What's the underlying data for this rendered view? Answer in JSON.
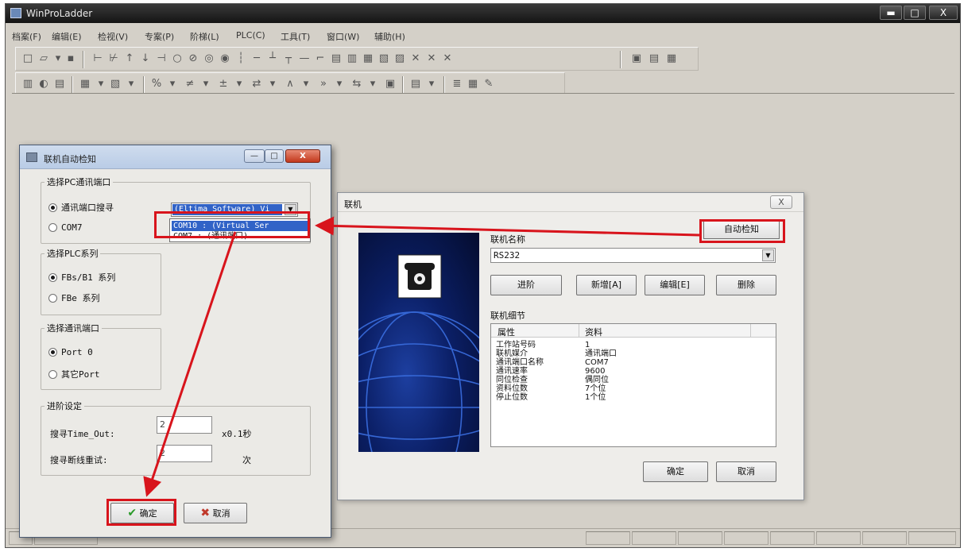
{
  "app": {
    "title": "WinProLadder",
    "window_buttons": [
      "▬",
      "□",
      "X"
    ],
    "menu": [
      "档案(F)",
      "编辑(E)",
      "检视(V)",
      "专案(P)",
      "阶梯(L)",
      "PLC(C)",
      "工具(T)",
      "窗口(W)",
      "辅助(H)"
    ]
  },
  "autodetect_dialog": {
    "title": "联机自动检知",
    "caption_buttons": [
      "—",
      "□",
      "X"
    ],
    "pc_port_group": {
      "legend": "选择PC通讯端口",
      "option_search": "通讯端口搜寻",
      "option_com7": "COM7",
      "combo_value": "(Eltima Software) Vi",
      "dropdown_items": [
        "COM10 : (Virtual Ser",
        "COM7 : (通讯端口)"
      ]
    },
    "plc_series_group": {
      "legend": "选择PLC系列",
      "option_fbs": "FBs/B1 系列",
      "option_fbe": "FBe 系列"
    },
    "comm_port_group": {
      "legend": "选择通讯端口",
      "option_port0": "Port 0",
      "option_other": "其它Port"
    },
    "advanced_group": {
      "legend": "进阶设定",
      "timeout_label": "搜寻Time_Out:",
      "timeout_value": "2",
      "timeout_unit": "x0.1秒",
      "retry_label": "搜寻断线重试:",
      "retry_value": "2",
      "retry_unit": "次"
    },
    "ok_label": "确定",
    "cancel_label": "取消"
  },
  "link_dialog": {
    "title": "联机",
    "close_label": "X",
    "auto_detect_label": "自动检知",
    "link_name_label": "联机名称",
    "link_name_value": "RS232",
    "buttons": [
      "进阶",
      "新增[A]",
      "编辑[E]",
      "删除"
    ],
    "details_label": "联机细节",
    "details_headers": [
      "属性",
      "资料"
    ],
    "details_rows": [
      [
        "工作站号码",
        "1"
      ],
      [
        "联机媒介",
        "通讯端口"
      ],
      [
        "通讯端口名称",
        "COM7"
      ],
      [
        "通讯速率",
        "9600"
      ],
      [
        "同位检查",
        "偶同位"
      ],
      [
        "资料位数",
        "7个位"
      ],
      [
        "停止位数",
        "1个位"
      ]
    ],
    "ok_label": "确定",
    "cancel_label": "取消"
  },
  "colors": {
    "annotation_red": "#d8141c",
    "selection_blue": "#3163c7",
    "ok_check": "#2a9a2a",
    "cancel_x": "#c0392b"
  }
}
